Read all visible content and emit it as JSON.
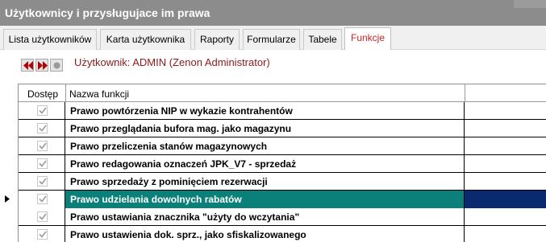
{
  "window": {
    "title": "Użytkownicy i przysługujace im prawa"
  },
  "tabs": [
    {
      "label": "Lista użytkowników"
    },
    {
      "label": "Karta użytkownika"
    },
    {
      "label": "Raporty"
    },
    {
      "label": "Formularze"
    },
    {
      "label": "Tabele"
    },
    {
      "label": "Funkcje",
      "active": true
    }
  ],
  "user": {
    "label": "Użytkownik: ADMIN  (Zenon Administrator)"
  },
  "grid": {
    "columns": {
      "access": "Dostęp",
      "name": "Nazwa funkcji"
    },
    "rows": [
      {
        "name": "Prawo powtórzenia NIP w wykazie kontrahentów",
        "checked": true
      },
      {
        "name": "Prawo przeglądania bufora mag. jako magazynu",
        "checked": true
      },
      {
        "name": "Prawo przeliczenia stanów magazynowych",
        "checked": true
      },
      {
        "name": "Prawo redagowania oznaczeń JPK_V7 - sprzedaż",
        "checked": true
      },
      {
        "name": "Prawo sprzedaży z pominięciem rezerwacji",
        "checked": true
      },
      {
        "name": "Prawo udzielania dowolnych rabatów",
        "checked": true,
        "selected": true
      },
      {
        "name": "Prawo ustawiania znacznika \"użyty do wczytania\"",
        "checked": true
      },
      {
        "name": "Prawo ustawienia dok. sprz., jako sfiskalizowanego",
        "checked": true
      }
    ]
  },
  "colors": {
    "selected_row": "#0b807b",
    "selected_bg": "#0a2a70",
    "user_label": "#8b1a1a",
    "active_tab": "#cc2222"
  },
  "icons": {
    "prev": "double-left-arrow-icon",
    "next": "double-right-arrow-icon",
    "record": "record-dot-icon"
  }
}
